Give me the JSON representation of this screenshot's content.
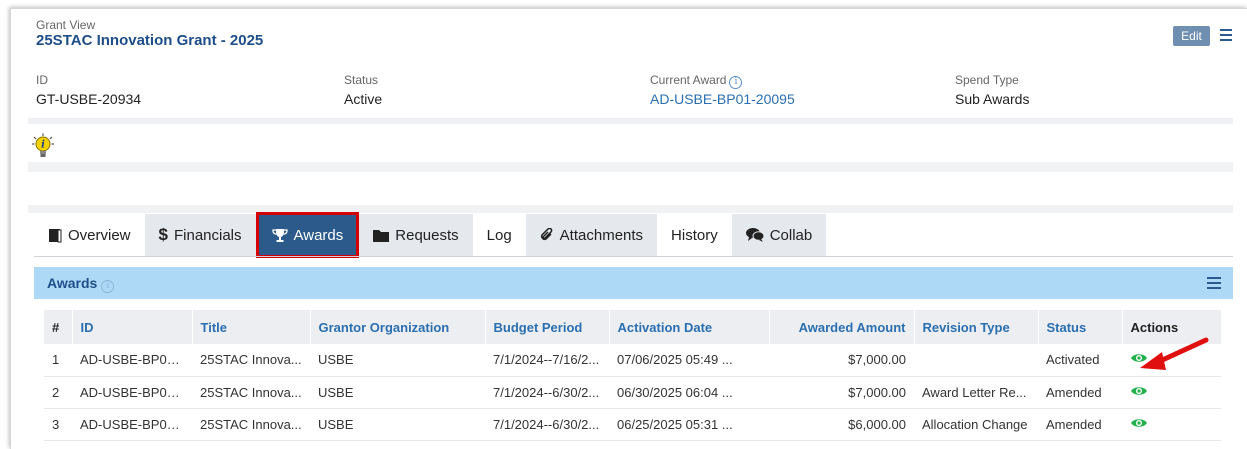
{
  "header": {
    "view_label": "Grant View",
    "title": "25STAC Innovation Grant - 2025",
    "edit_label": "Edit"
  },
  "fields": {
    "id_label": "ID",
    "id_value": "GT-USBE-20934",
    "status_label": "Status",
    "status_value": "Active",
    "current_award_label": "Current Award",
    "current_award_value": "AD-USBE-BP01-20095",
    "spend_type_label": "Spend Type",
    "spend_type_value": "Sub Awards"
  },
  "tabs": [
    {
      "label": "Overview",
      "icon": "book-icon"
    },
    {
      "label": "Financials",
      "icon": "dollar-icon"
    },
    {
      "label": "Awards",
      "icon": "trophy-icon",
      "active": true
    },
    {
      "label": "Requests",
      "icon": "folder-icon"
    },
    {
      "label": "Log",
      "icon": ""
    },
    {
      "label": "Attachments",
      "icon": "paperclip-icon"
    },
    {
      "label": "History",
      "icon": ""
    },
    {
      "label": "Collab",
      "icon": "comments-icon"
    }
  ],
  "awards_panel": {
    "title": "Awards",
    "columns": [
      "#",
      "ID",
      "Title",
      "Grantor Organization",
      "Budget Period",
      "Activation Date",
      "Awarded Amount",
      "Revision Type",
      "Status",
      "Actions"
    ],
    "rows": [
      {
        "num": "1",
        "id": "AD-USBE-BP01...",
        "title": "25STAC Innova...",
        "grantor": "USBE",
        "budget_period": "7/1/2024--7/16/2...",
        "activation": "07/06/2025 05:49 ...",
        "amount": "$7,000.00",
        "revision": "",
        "status": "Activated"
      },
      {
        "num": "2",
        "id": "AD-USBE-BP01...",
        "title": "25STAC Innova...",
        "grantor": "USBE",
        "budget_period": "7/1/2024--6/30/2...",
        "activation": "06/30/2025 06:04 ...",
        "amount": "$7,000.00",
        "revision": "Award Letter Re...",
        "status": "Amended"
      },
      {
        "num": "3",
        "id": "AD-USBE-BP01...",
        "title": "25STAC Innova...",
        "grantor": "USBE",
        "budget_period": "7/1/2024--6/30/2...",
        "activation": "06/25/2025 05:31 ...",
        "amount": "$6,000.00",
        "revision": "Allocation Change",
        "status": "Amended"
      }
    ]
  },
  "colors": {
    "primary": "#1d4e89",
    "active_tab": "#2b5a8b",
    "highlight": "#d40000",
    "panel_header": "#add9f7",
    "view_icon": "#22b14c"
  }
}
